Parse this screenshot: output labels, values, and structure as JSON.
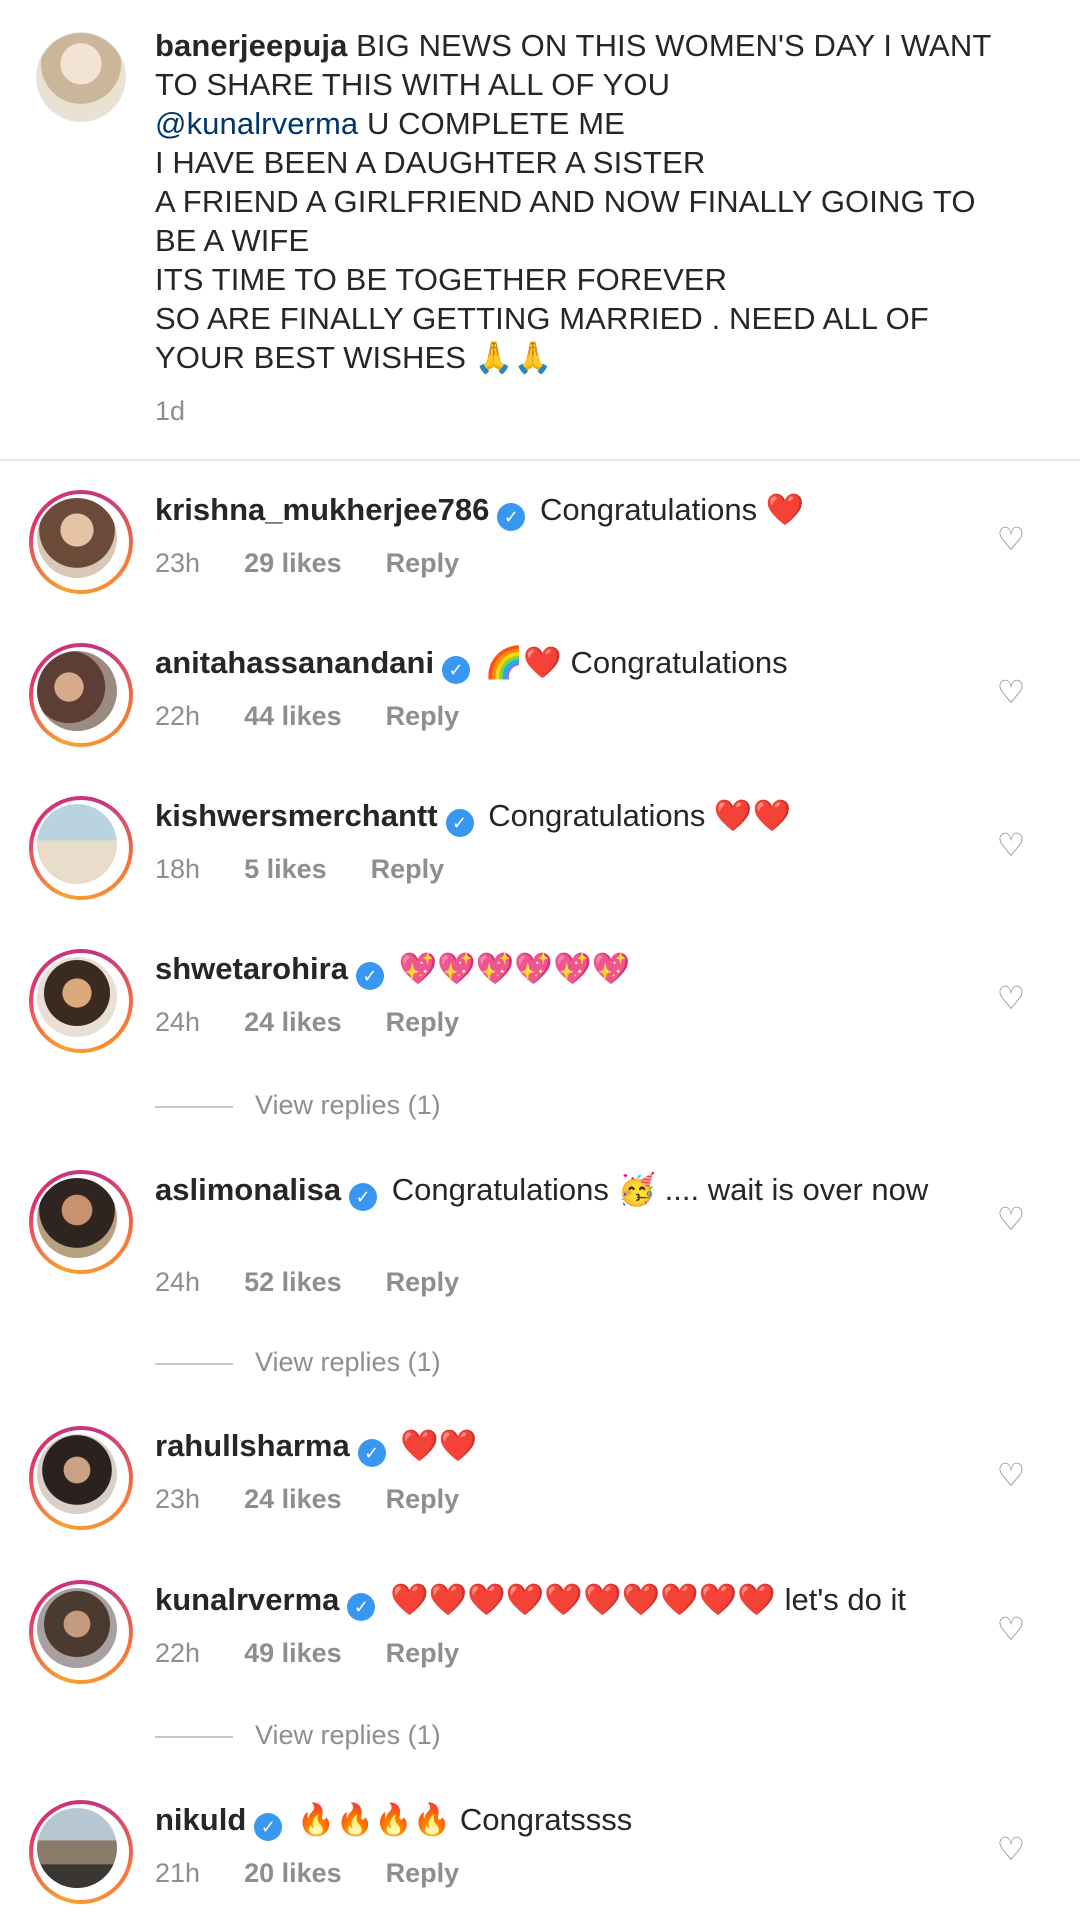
{
  "caption": {
    "username": "banerjeepuja",
    "text_before": "BIG NEWS ON THIS WOMEN'S DAY I WANT TO SHARE THIS WITH ALL OF YOU\n",
    "mention": "@kunalrverma",
    "text_after": " U COMPLETE ME\nI HAVE BEEN A DAUGHTER A SISTER\nA FRIEND A GIRLFRIEND AND NOW FINALLY GOING TO BE A WIFE\nITS TIME TO BE TOGETHER FOREVER\nSO ARE FINALLY GETTING MARRIED . NEED ALL OF YOUR BEST WISHES 🙏🙏",
    "time": "1d"
  },
  "comments": [
    {
      "username": "krishna_mukherjee786",
      "text": "Congratulations ❤️",
      "time": "23h",
      "likes": "29 likes",
      "reply": "Reply"
    },
    {
      "username": "anitahassanandani",
      "text": "🌈❤️ Congratulations",
      "time": "22h",
      "likes": "44 likes",
      "reply": "Reply"
    },
    {
      "username": "kishwersmerchantt",
      "text": "Congratulations ❤️❤️",
      "time": "18h",
      "likes": "5 likes",
      "reply": "Reply"
    },
    {
      "username": "shwetarohira",
      "text": "💖💖💖💖💖💖",
      "time": "24h",
      "likes": "24 likes",
      "reply": "Reply"
    },
    {
      "username": "aslimonalisa",
      "text": "Congratulations 🥳 .... wait is over now",
      "time": "24h",
      "likes": "52 likes",
      "reply": "Reply"
    },
    {
      "username": "rahullsharma",
      "text": "❤️❤️",
      "time": "23h",
      "likes": "24 likes",
      "reply": "Reply"
    },
    {
      "username": "kunalrverma",
      "text": "❤️❤️❤️❤️❤️❤️❤️❤️❤️❤️ let's do it",
      "time": "22h",
      "likes": "49 likes",
      "reply": "Reply"
    },
    {
      "username": "nikuld",
      "text": "🔥🔥🔥🔥 Congratssss",
      "time": "21h",
      "likes": "20 likes",
      "reply": "Reply"
    }
  ],
  "view_replies": [
    "View replies (1)",
    "View replies (1)",
    "View replies (1)"
  ],
  "icons": {
    "verified": "verified-badge-icon",
    "like": "heart-outline-icon"
  },
  "colors": {
    "verified": "#3897f0",
    "muted": "#8e8e8e",
    "mention": "#00376b",
    "text": "#262626"
  }
}
